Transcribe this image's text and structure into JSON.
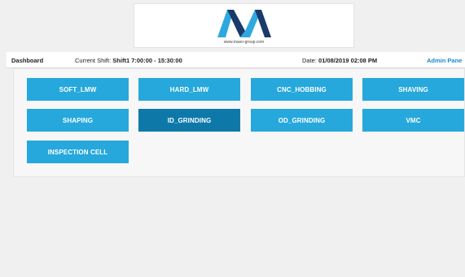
{
  "logo": {
    "url_text": "www.maso-group.com",
    "colors": {
      "light": "#2fa8e0",
      "dark": "#1a3a6b"
    }
  },
  "status_bar": {
    "dashboard_label": "Dashboard",
    "shift_label": "Current Shift:",
    "shift_value": "Shift1 7:00:00 - 15:30:00",
    "date_label": "Date:",
    "date_value": "01/08/2019 02:08 PM",
    "admin_link": "Admin Pane"
  },
  "machines": [
    {
      "label": "SOFT_LMW"
    },
    {
      "label": "HARD_LMW"
    },
    {
      "label": "CNC_HOBBING"
    },
    {
      "label": "SHAVING"
    },
    {
      "label": "SHAPING"
    },
    {
      "label": "ID_GRINDING",
      "active": true
    },
    {
      "label": "OD_GRINDING"
    },
    {
      "label": "VMC"
    },
    {
      "label": "INSPECTION CELL"
    }
  ],
  "colors": {
    "button": "#26a8dc",
    "button_active": "#0e79a8",
    "admin_link": "#1e88c8"
  }
}
